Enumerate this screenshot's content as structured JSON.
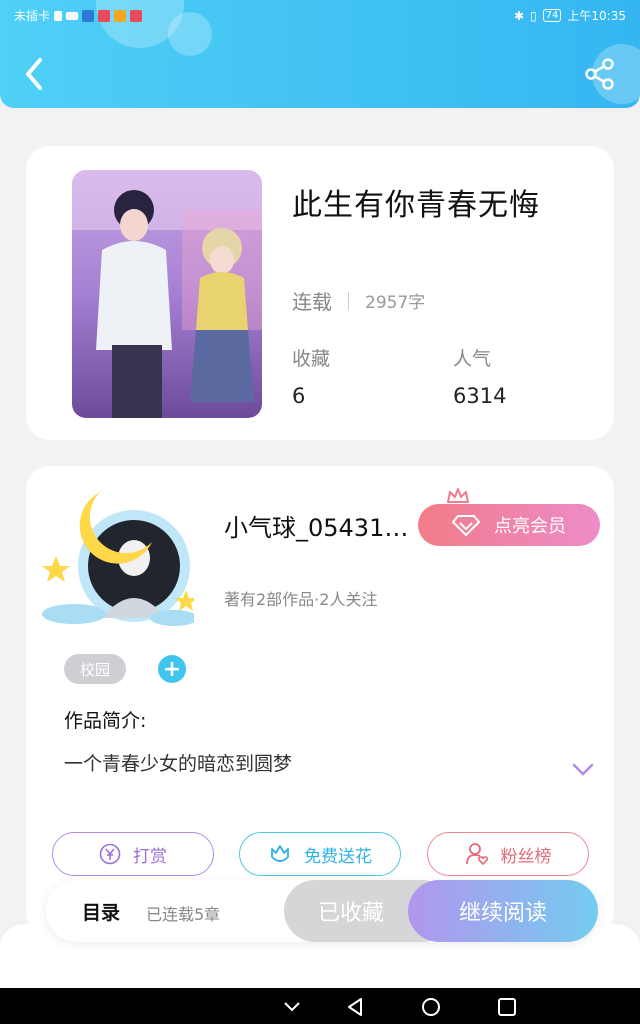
{
  "status_bar": {
    "carrier": "未插卡",
    "time": "上午10:35",
    "battery": "74"
  },
  "book": {
    "title": "此生有你青春无悔",
    "status": "连载",
    "word_count": "2957字",
    "favorites_label": "收藏",
    "favorites_value": "6",
    "popularity_label": "人气",
    "popularity_value": "6314"
  },
  "author": {
    "name": "小气球_05431…",
    "vip_label": "点亮会员",
    "meta": "著有2部作品·2人关注"
  },
  "tags": [
    "校园"
  ],
  "intro": {
    "title": "作品简介:",
    "text": "一个青春少女的暗恋到圆梦"
  },
  "actions": {
    "tip": "打赏",
    "flower": "免费送花",
    "fans": "粉丝榜"
  },
  "bottom": {
    "toc": "目录",
    "chapters": "已连载5章",
    "collected": "已收藏",
    "continue": "继续阅读"
  },
  "colors": {
    "header": "#35b6f1",
    "accent_purple": "#9b6fd9",
    "accent_cyan": "#2fb3e5",
    "accent_red": "#e46b77"
  }
}
